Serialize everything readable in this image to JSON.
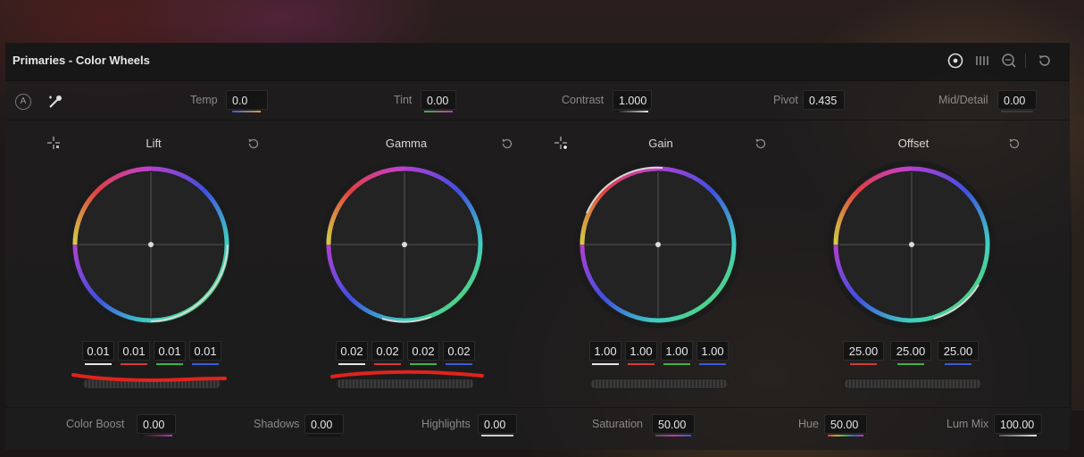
{
  "panel": {
    "title": "Primaries - Color Wheels",
    "header_icons": [
      "wheels-mode-icon",
      "bars-mode-icon",
      "log-mode-icon",
      "reset-all-icon"
    ]
  },
  "params": {
    "auto": "A",
    "temp": {
      "label": "Temp",
      "value": "0.0"
    },
    "tint": {
      "label": "Tint",
      "value": "0.00"
    },
    "contrast": {
      "label": "Contrast",
      "value": "1.000"
    },
    "pivot": {
      "label": "Pivot",
      "value": "0.435"
    },
    "mid_detail": {
      "label": "Mid/Detail",
      "value": "0.00"
    }
  },
  "wheels": {
    "lift": {
      "title": "Lift",
      "values": [
        "0.01",
        "0.01",
        "0.01",
        "0.01"
      ]
    },
    "gamma": {
      "title": "Gamma",
      "values": [
        "0.02",
        "0.02",
        "0.02",
        "0.02"
      ]
    },
    "gain": {
      "title": "Gain",
      "values": [
        "1.00",
        "1.00",
        "1.00",
        "1.00"
      ]
    },
    "offset": {
      "title": "Offset",
      "values": [
        "25.00",
        "25.00",
        "25.00"
      ]
    }
  },
  "bottom": {
    "color_boost": {
      "label": "Color Boost",
      "value": "0.00"
    },
    "shadows": {
      "label": "Shadows",
      "value": "0.00"
    },
    "highlights": {
      "label": "Highlights",
      "value": "0.00"
    },
    "saturation": {
      "label": "Saturation",
      "value": "50.00"
    },
    "hue": {
      "label": "Hue",
      "value": "50.00"
    },
    "lum_mix": {
      "label": "Lum Mix",
      "value": "100.00"
    }
  },
  "colors": {
    "master": "#e6e6e6",
    "red": "#d43a3a",
    "green": "#3fb24a",
    "blue": "#3a5ad8",
    "annotation": "#e0231c"
  }
}
